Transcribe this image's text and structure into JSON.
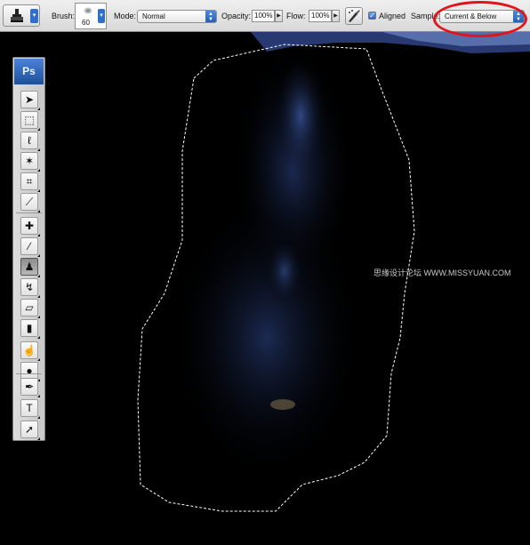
{
  "options_bar": {
    "tool_preset_icon": "clone-stamp-icon",
    "brush_label": "Brush:",
    "brush_size": "60",
    "mode_label": "Mode:",
    "mode_value": "Normal",
    "opacity_label": "Opacity:",
    "opacity_value": "100%",
    "flow_label": "Flow:",
    "flow_value": "100%",
    "airbrush_icon": "airbrush-icon",
    "aligned_label": "Aligned",
    "aligned_checked": true,
    "sample_label": "Sample:",
    "sample_value": "Current & Below",
    "highlight_color": "#e0141b"
  },
  "toolbox": {
    "logo": "Ps",
    "tools": [
      {
        "name": "move-tool",
        "icon": "move-icon",
        "glyph": "➤"
      },
      {
        "name": "marquee-tool",
        "icon": "marquee-icon",
        "glyph": "⬚"
      },
      {
        "name": "lasso-tool",
        "icon": "lasso-icon",
        "glyph": "ℓ"
      },
      {
        "name": "magic-wand-tool",
        "icon": "magic-wand-icon",
        "glyph": "✶"
      },
      {
        "name": "crop-tool",
        "icon": "crop-icon",
        "glyph": "⌗"
      },
      {
        "name": "slice-tool",
        "icon": "slice-icon",
        "glyph": "⟋"
      },
      {
        "name": "healing-brush-tool",
        "icon": "bandage-icon",
        "glyph": "✚"
      },
      {
        "name": "brush-tool",
        "icon": "brush-icon",
        "glyph": "⁄"
      },
      {
        "name": "clone-stamp-tool",
        "icon": "clone-stamp-icon",
        "glyph": "♟",
        "active": true
      },
      {
        "name": "history-brush-tool",
        "icon": "history-brush-icon",
        "glyph": "↯"
      },
      {
        "name": "eraser-tool",
        "icon": "eraser-icon",
        "glyph": "▱"
      },
      {
        "name": "gradient-tool",
        "icon": "gradient-icon",
        "glyph": "▮"
      },
      {
        "name": "blur-tool",
        "icon": "smudge-icon",
        "glyph": "☝"
      },
      {
        "name": "dodge-tool",
        "icon": "dodge-icon",
        "glyph": "●"
      },
      {
        "name": "pen-tool",
        "icon": "pen-icon",
        "glyph": "✒"
      },
      {
        "name": "type-tool",
        "icon": "type-icon",
        "glyph": "T"
      },
      {
        "name": "path-selection-tool",
        "icon": "arrow-icon",
        "glyph": "➚"
      }
    ]
  },
  "canvas": {
    "background_color": "#000000",
    "watermark": "思缘设计论坛 WWW.MISSYUAN.COM"
  }
}
